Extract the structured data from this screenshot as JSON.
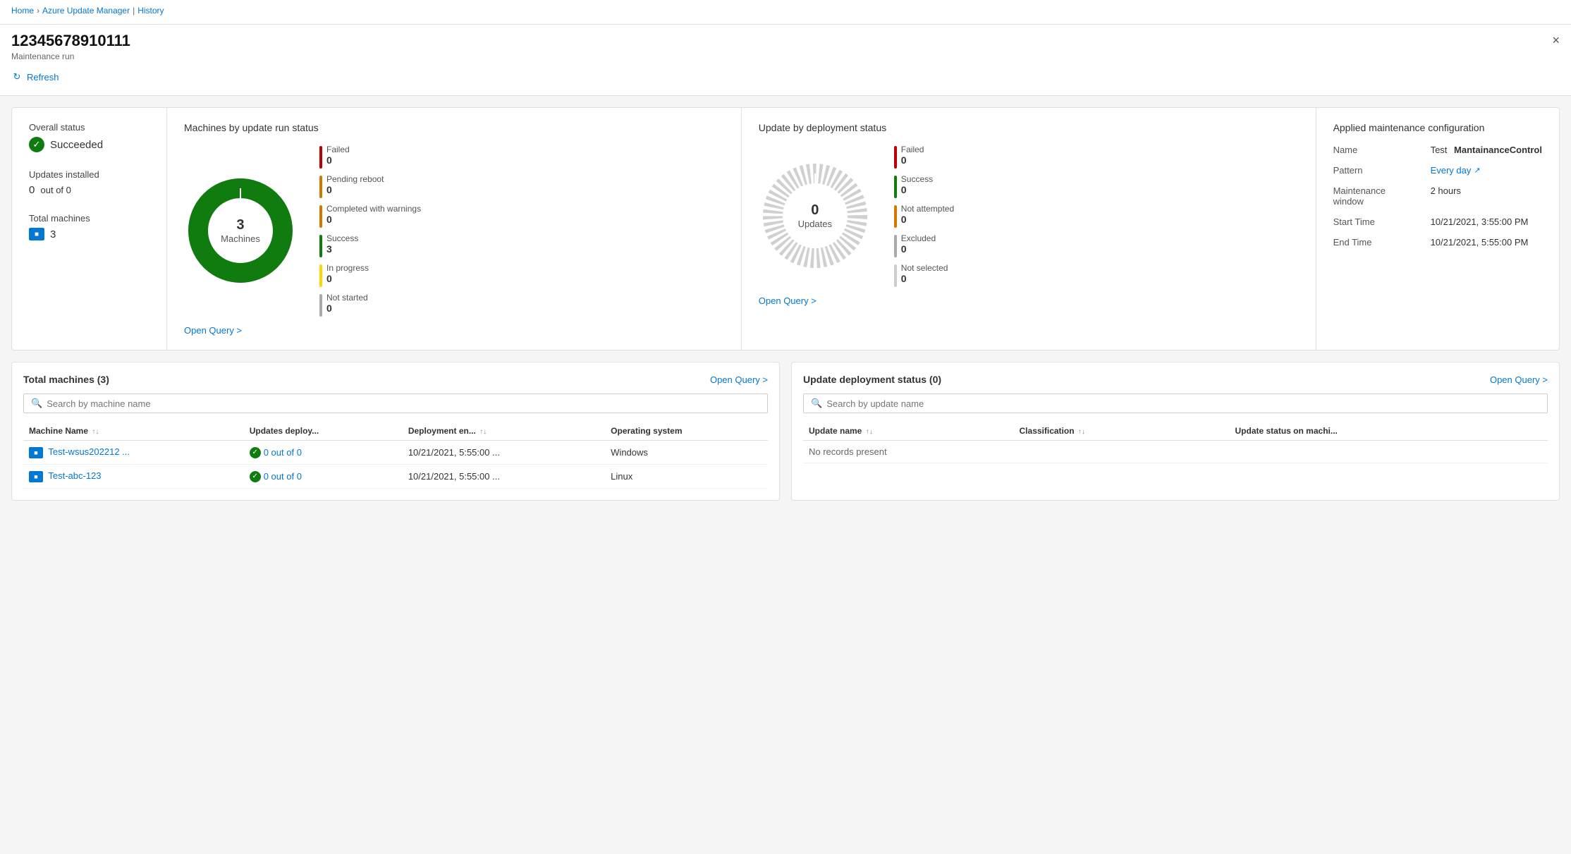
{
  "breadcrumb": {
    "home": "Home",
    "azure_update_manager": "Azure Update Manager",
    "history": "History"
  },
  "page": {
    "title": "12345678910111",
    "subtitle": "Maintenance run",
    "close_label": "×",
    "refresh_label": "Refresh"
  },
  "summary": {
    "overall_status_label": "Overall status",
    "status_value": "Succeeded",
    "updates_installed_label": "Updates installed",
    "updates_installed_value": "0",
    "out_of": "out of 0",
    "total_machines_label": "Total machines",
    "total_machines_value": "3"
  },
  "machines_chart": {
    "title": "Machines by update run status",
    "center_number": "3",
    "center_text": "Machines",
    "open_query": "Open Query >",
    "legend": [
      {
        "label": "Failed",
        "value": "0",
        "color": "#c00000"
      },
      {
        "label": "Pending reboot",
        "value": "0",
        "color": "#d47900"
      },
      {
        "label": "Completed with warnings",
        "value": "0",
        "color": "#d47900"
      },
      {
        "label": "Success",
        "value": "3",
        "color": "#107c10"
      },
      {
        "label": "In progress",
        "value": "0",
        "color": "#ffd700"
      },
      {
        "label": "Not started",
        "value": "0",
        "color": "#aaa"
      }
    ]
  },
  "deployment_chart": {
    "title": "Update by deployment status",
    "center_number": "0",
    "center_text": "Updates",
    "open_query": "Open Query >",
    "legend": [
      {
        "label": "Failed",
        "value": "0",
        "color": "#c00000"
      },
      {
        "label": "Success",
        "value": "0",
        "color": "#107c10"
      },
      {
        "label": "Not attempted",
        "value": "0",
        "color": "#d47900"
      },
      {
        "label": "Excluded",
        "value": "0",
        "color": "#aaa"
      },
      {
        "label": "Not selected",
        "value": "0",
        "color": "#ccc"
      }
    ]
  },
  "config": {
    "title": "Applied maintenance configuration",
    "rows": [
      {
        "key": "Name",
        "value": "MantainanceControl",
        "bold": true,
        "prefix": "Test"
      },
      {
        "key": "Pattern",
        "value": "Every day",
        "is_link": true
      },
      {
        "key": "Maintenance window",
        "value": "2 hours"
      },
      {
        "key": "Start Time",
        "value": "10/21/2021, 3:55:00 PM"
      },
      {
        "key": "End Time",
        "value": "10/21/2021, 5:55:00 PM"
      }
    ]
  },
  "machines_table": {
    "title": "Total machines (3)",
    "open_query": "Open Query >",
    "search_placeholder": "Search by machine name",
    "columns": [
      {
        "label": "Machine Name",
        "sortable": true
      },
      {
        "label": "Updates deploy...",
        "sortable": false
      },
      {
        "label": "Deployment en...",
        "sortable": true
      },
      {
        "label": "Operating system",
        "sortable": false
      }
    ],
    "rows": [
      {
        "name": "Test-wsus202212 ...",
        "updates": "0 out of 0",
        "deployment_end": "10/21/2021, 5:55:00 ...",
        "os": "Windows"
      },
      {
        "name": "Test-abc-123",
        "updates": "0 out of 0",
        "deployment_end": "10/21/2021, 5:55:00 ...",
        "os": "Linux"
      }
    ]
  },
  "updates_table": {
    "title": "Update deployment status (0)",
    "open_query": "Open Query >",
    "search_placeholder": "Search by update name",
    "columns": [
      {
        "label": "Update name",
        "sortable": true
      },
      {
        "label": "Classification",
        "sortable": true
      },
      {
        "label": "Update status on machi...",
        "sortable": false
      }
    ],
    "no_records": "No records present"
  },
  "icons": {
    "search": "🔍",
    "refresh": "↻",
    "check": "✓",
    "external": "↗",
    "machine": "🖥",
    "sort": "↑↓"
  }
}
